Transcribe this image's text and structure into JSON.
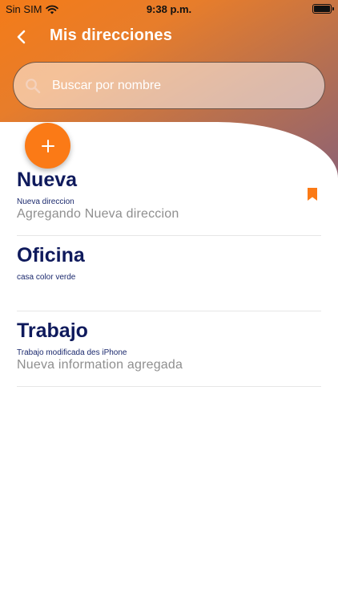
{
  "status_bar": {
    "carrier": "Sin SIM",
    "time": "9:38 p.m.",
    "battery_level": 1.0
  },
  "header": {
    "title": "Mis direcciones",
    "back_icon": "chevron-left-icon"
  },
  "search": {
    "placeholder": "Buscar por nombre",
    "value": "",
    "icon": "search-icon"
  },
  "add_button": {
    "icon": "plus-icon",
    "color": "#fb7a16"
  },
  "addresses": [
    {
      "name": "Nueva",
      "detail": "Nueva direccion",
      "note": "Agregando Nueva direccion",
      "bookmarked": true
    },
    {
      "name": "Oficina",
      "detail": "casa color verde",
      "note": "",
      "bookmarked": false
    },
    {
      "name": "Trabajo",
      "detail": "Trabajo modificada des iPhone",
      "note": "Nueva information agregada",
      "bookmarked": false
    }
  ],
  "colors": {
    "accent": "#fb7a16",
    "title_text": "#0f1a5c",
    "gradient_start": "#f47b18",
    "gradient_end": "#8a6177"
  }
}
